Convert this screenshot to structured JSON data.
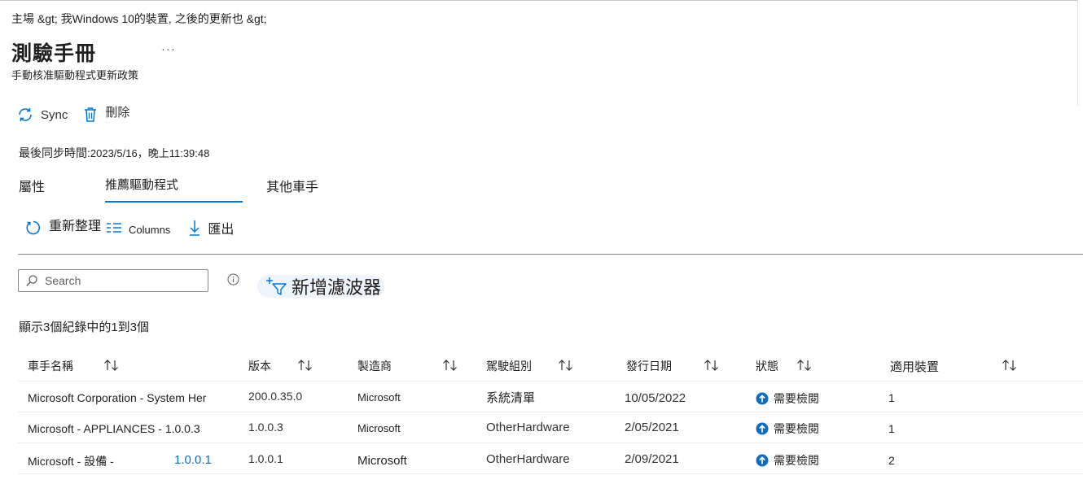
{
  "breadcrumb": "主場 &gt;  我Windows  10的裝置, 之後的更新也 &gt;",
  "page": {
    "title": "測驗手冊",
    "more": "···",
    "subtitle": "手動核准驅動程式更新政策"
  },
  "commands": {
    "sync_label": "Sync",
    "delete_label": "刪除"
  },
  "last_sync": {
    "label": "最後同步時間:",
    "value": "2023/5/16，晚上11:39:48"
  },
  "tabs": [
    {
      "label": "屬性"
    },
    {
      "label": "推薦驅動程式"
    },
    {
      "label": "其他車手"
    }
  ],
  "toolbar": {
    "refresh_label": "重新整理",
    "columns_label": "Columns",
    "export_label": "匯出"
  },
  "search": {
    "placeholder": "Search"
  },
  "filter": {
    "label": "新增濾波器"
  },
  "record_count": "顯示3個紀錄中的1到3個",
  "table": {
    "columns": [
      {
        "label": "車手名稱"
      },
      {
        "label": "版本"
      },
      {
        "label": "製造商"
      },
      {
        "label": "駕駛組別"
      },
      {
        "label": "發行日期"
      },
      {
        "label": "狀態"
      },
      {
        "label": "適用裝置"
      }
    ],
    "rows": [
      {
        "name": "Microsoft Corporation - System Her",
        "name_suffix": "",
        "version": "200.0.35.0",
        "manufacturer": "Microsoft",
        "class": "系統清單",
        "date": "10/05/2022",
        "status": "需要檢閱",
        "devices": "1"
      },
      {
        "name": "Microsoft - APPLIANCES - 1.0.0.3",
        "name_suffix": "",
        "version": "1.0.0.3",
        "manufacturer": "Microsoft",
        "class": "OtherHardware",
        "date": "2/05/2021",
        "status": "需要檢閱",
        "devices": "1"
      },
      {
        "name": "Microsoft - 設備 -",
        "name_suffix": "1.0.0.1",
        "version": "1.0.0.1",
        "manufacturer": "Microsoft",
        "class": "OtherHardware",
        "date": "2/09/2021",
        "status": "需要檢閱",
        "devices": "2"
      }
    ]
  },
  "colors": {
    "accent": "#0078d4",
    "status_icon": "#0f6cbd"
  },
  "icons": {
    "sync": "sync-icon",
    "delete": "trash-icon",
    "refresh": "refresh-icon",
    "columns": "columns-icon",
    "export": "download-icon",
    "search": "search-icon",
    "info": "info-icon",
    "filter": "add-filter-icon",
    "sort": "sort-arrows-icon",
    "status": "up-arrow-circle-icon"
  }
}
